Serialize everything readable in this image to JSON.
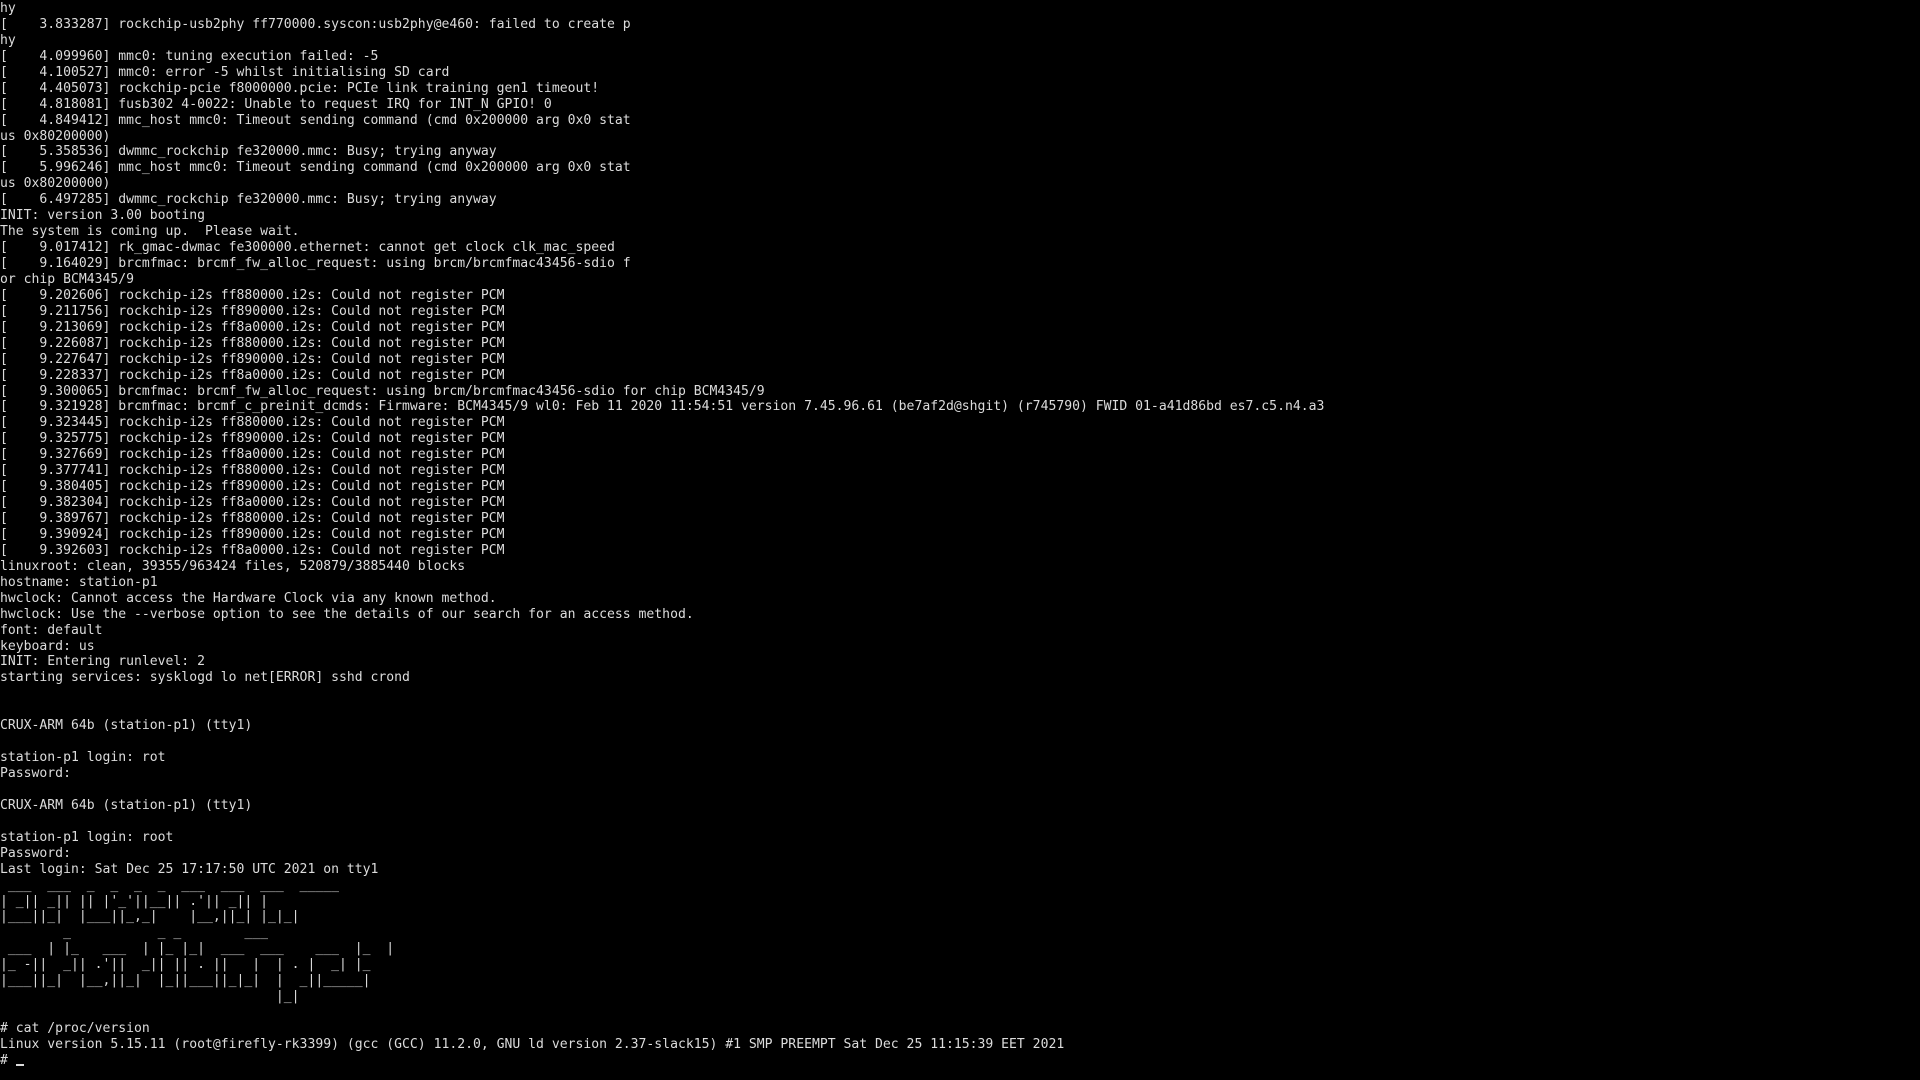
{
  "colors": {
    "background": "#000000",
    "text": "#dcdcdc"
  },
  "terminal": {
    "lines": [
      "hy",
      "[    3.833287] rockchip-usb2phy ff770000.syscon:usb2phy@e460: failed to create p",
      "hy",
      "[    4.099960] mmc0: tuning execution failed: -5",
      "[    4.100527] mmc0: error -5 whilst initialising SD card",
      "[    4.405073] rockchip-pcie f8000000.pcie: PCIe link training gen1 timeout!",
      "[    4.818081] fusb302 4-0022: Unable to request IRQ for INT_N GPIO! 0",
      "[    4.849412] mmc_host mmc0: Timeout sending command (cmd 0x200000 arg 0x0 stat",
      "us 0x80200000)",
      "[    5.358536] dwmmc_rockchip fe320000.mmc: Busy; trying anyway",
      "[    5.996246] mmc_host mmc0: Timeout sending command (cmd 0x200000 arg 0x0 stat",
      "us 0x80200000)",
      "[    6.497285] dwmmc_rockchip fe320000.mmc: Busy; trying anyway",
      "INIT: version 3.00 booting",
      "The system is coming up.  Please wait.",
      "[    9.017412] rk_gmac-dwmac fe300000.ethernet: cannot get clock clk_mac_speed",
      "[    9.164029] brcmfmac: brcmf_fw_alloc_request: using brcm/brcmfmac43456-sdio f",
      "or chip BCM4345/9",
      "[    9.202606] rockchip-i2s ff880000.i2s: Could not register PCM",
      "[    9.211756] rockchip-i2s ff890000.i2s: Could not register PCM",
      "[    9.213069] rockchip-i2s ff8a0000.i2s: Could not register PCM",
      "[    9.226087] rockchip-i2s ff880000.i2s: Could not register PCM",
      "[    9.227647] rockchip-i2s ff890000.i2s: Could not register PCM",
      "[    9.228337] rockchip-i2s ff8a0000.i2s: Could not register PCM",
      "[    9.300065] brcmfmac: brcmf_fw_alloc_request: using brcm/brcmfmac43456-sdio for chip BCM4345/9",
      "[    9.321928] brcmfmac: brcmf_c_preinit_dcmds: Firmware: BCM4345/9 wl0: Feb 11 2020 11:54:51 version 7.45.96.61 (be7af2d@shgit) (r745790) FWID 01-a41d86bd es7.c5.n4.a3",
      "[    9.323445] rockchip-i2s ff880000.i2s: Could not register PCM",
      "[    9.325775] rockchip-i2s ff890000.i2s: Could not register PCM",
      "[    9.327669] rockchip-i2s ff8a0000.i2s: Could not register PCM",
      "[    9.377741] rockchip-i2s ff880000.i2s: Could not register PCM",
      "[    9.380405] rockchip-i2s ff890000.i2s: Could not register PCM",
      "[    9.382304] rockchip-i2s ff8a0000.i2s: Could not register PCM",
      "[    9.389767] rockchip-i2s ff880000.i2s: Could not register PCM",
      "[    9.390924] rockchip-i2s ff890000.i2s: Could not register PCM",
      "[    9.392603] rockchip-i2s ff8a0000.i2s: Could not register PCM",
      "linuxroot: clean, 39355/963424 files, 520879/3885440 blocks",
      "hostname: station-p1",
      "hwclock: Cannot access the Hardware Clock via any known method.",
      "hwclock: Use the --verbose option to see the details of our search for an access method.",
      "font: default",
      "keyboard: us",
      "INIT: Entering runlevel: 2",
      "starting services: sysklogd lo net[ERROR] sshd crond",
      "",
      "",
      "CRUX-ARM 64b (station-p1) (tty1)",
      "",
      "station-p1 login: rot",
      "Password:",
      "",
      "CRUX-ARM 64b (station-p1) (tty1)",
      "",
      "station-p1 login: root",
      "Password:",
      "Last login: Sat Dec 25 17:17:50 UTC 2021 on tty1",
      " ___  ___  _  _  _  _  ___  ___  ___  _____",
      "| _|| _|| || |'_'||__|| .'|| _|| |",
      "|___||_|  |___||_,_|    |__,||_| |_|_|",
      "        _           _ _        ___",
      " ___  | |_   ___  | |_ |_|  ___  ___    ___  |_  |",
      "|_ -||  _|| .'||  _|| || . ||   |  | . |  _| |_",
      "|___||_|  |__,||_|  |_||___||_|_|  |  _||_____|",
      "                                   |_|",
      "",
      "# cat /proc/version",
      "Linux version 5.15.11 (root@firefly-rk3399) (gcc (GCC) 11.2.0, GNU ld version 2.37-slack15) #1 SMP PREEMPT Sat Dec 25 11:15:39 EET 2021"
    ],
    "prompt": "# "
  }
}
